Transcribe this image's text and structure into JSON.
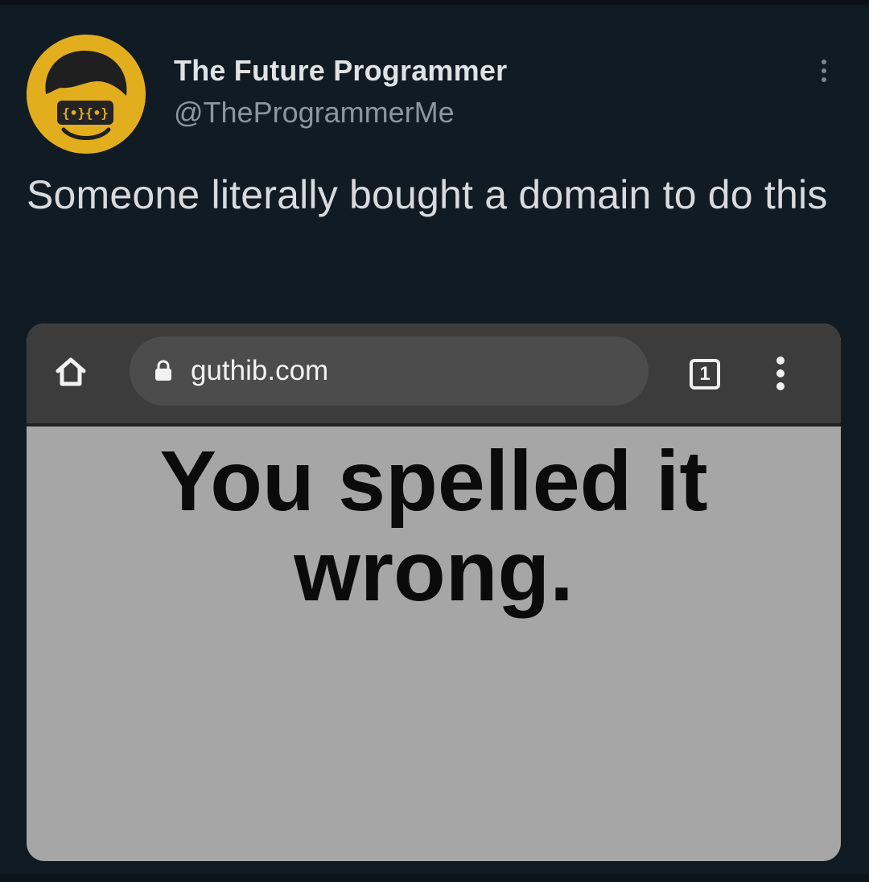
{
  "tweet": {
    "author_name": "The Future Programmer",
    "author_handle": "@TheProgrammerMe",
    "avatar_icon": "programmer-face-icon",
    "more_icon": "more-vertical-icon",
    "text": "Someone literally bought a domain to do this"
  },
  "media": {
    "browser": {
      "home_icon": "home-icon",
      "lock_icon": "lock-icon",
      "url": "guthib.com",
      "tab_count": "1",
      "menu_icon": "more-vertical-icon"
    },
    "page_message": "You spelled it wrong."
  },
  "colors": {
    "background": "#111b23",
    "avatar_ring": "#e2ae1d",
    "name": "#dfe3e6",
    "handle": "#8c969e",
    "tweet_text": "#d7dbde",
    "browser_bar": "#3c3c3c",
    "page_background": "#a6a6a6",
    "page_text": "#0b0b0b"
  }
}
